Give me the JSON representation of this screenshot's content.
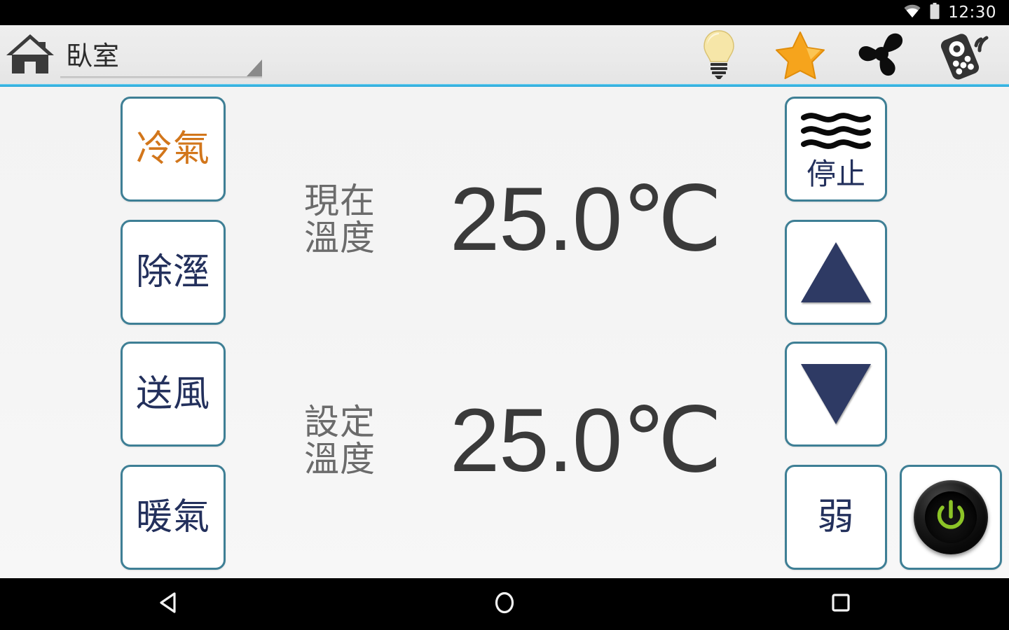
{
  "statusbar": {
    "clock": "12:30",
    "icons": [
      {
        "name": "wifi-icon"
      },
      {
        "name": "battery-icon"
      }
    ]
  },
  "appbar": {
    "home_icon": "home-icon",
    "room_selector": {
      "value": "臥室",
      "caret_icon": "spinner-caret-icon"
    },
    "icons": [
      {
        "name": "light-bulb-icon",
        "color": "#f7dd8c"
      },
      {
        "name": "star-icon",
        "color": "#f7a41d"
      },
      {
        "name": "fan-icon",
        "color": "#111111"
      },
      {
        "name": "remote-control-icon",
        "color": "#333333"
      }
    ]
  },
  "modes": [
    {
      "label": "冷氣",
      "active": true
    },
    {
      "label": "除溼",
      "active": false
    },
    {
      "label": "送風",
      "active": false
    },
    {
      "label": "暖氣",
      "active": false
    }
  ],
  "readouts": [
    {
      "label": "現在\n溫度",
      "label_line1": "現在",
      "label_line2": "溫度",
      "value": "25.0℃"
    },
    {
      "label": "設定\n溫度",
      "label_line1": "設定",
      "label_line2": "溫度",
      "value": "25.0℃"
    }
  ],
  "controls": {
    "swing": {
      "label": "停止",
      "icon": "wavy-lines-icon"
    },
    "temp_up": {
      "icon": "triangle-up-icon"
    },
    "temp_down": {
      "icon": "triangle-down-icon"
    },
    "fan_speed": {
      "label": "弱"
    },
    "power": {
      "icon": "power-button-icon"
    }
  },
  "navbar": [
    {
      "name": "nav-back-button",
      "icon": "back-triangle-icon"
    },
    {
      "name": "nav-home-button",
      "icon": "home-circle-icon"
    },
    {
      "name": "nav-recents-button",
      "icon": "recents-square-icon"
    }
  ],
  "colors": {
    "accent_line": "#33b5e5",
    "button_border": "#3e7f95",
    "label_navy": "#23305c",
    "active_orange": "#d2761b",
    "power_green": "#82be1e",
    "readout_grey": "#6b6b6b"
  }
}
